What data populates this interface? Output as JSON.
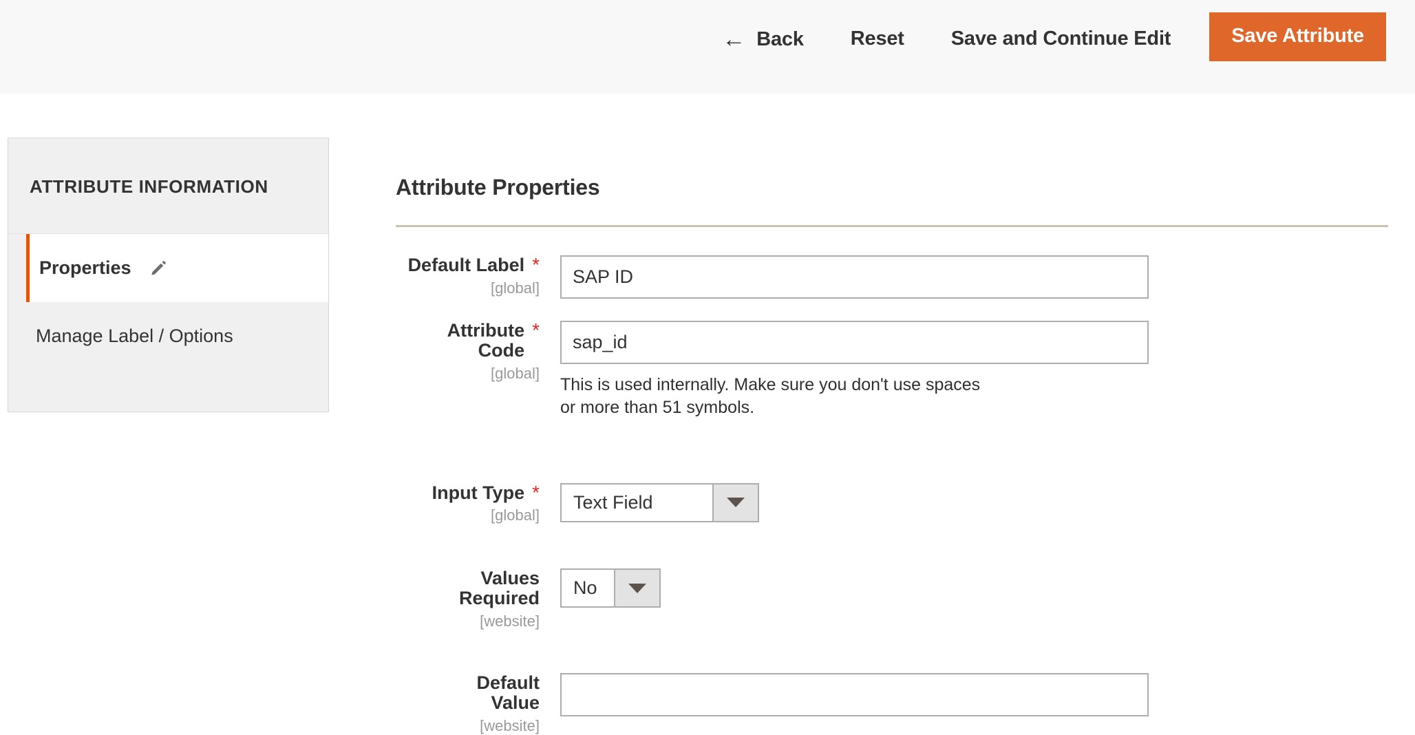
{
  "header": {
    "back_label": "Back",
    "back_icon": "arrow-left-icon",
    "reset_label": "Reset",
    "save_continue_label": "Save and Continue Edit",
    "save_label": "Save Attribute",
    "primary_color": "#e0672a",
    "bar_color": "#f8f8f8"
  },
  "sidebar": {
    "title": "ATTRIBUTE INFORMATION",
    "items": [
      {
        "label": "Properties",
        "active": true,
        "icon": "pencil-icon"
      },
      {
        "label": "Manage Label / Options",
        "active": false
      }
    ],
    "active_accent_color": "#eb5202"
  },
  "main": {
    "section_title": "Attribute Properties",
    "fields": {
      "default_label": {
        "label": "Default Label",
        "required_marker": "*",
        "scope": "[global]",
        "value": "SAP ID"
      },
      "attribute_code": {
        "label": "Attribute Code",
        "required_marker": "*",
        "scope": "[global]",
        "value": "sap_id",
        "note": "This is used internally. Make sure you don't use spaces or more than 51 symbols."
      },
      "input_type": {
        "label": "Input Type",
        "required_marker": "*",
        "scope": "[global]",
        "value": "Text Field"
      },
      "values_required": {
        "label_line1": "Values",
        "label_line2": "Required",
        "scope": "[website]",
        "value": "No"
      },
      "default_value": {
        "label_line1": "Default",
        "label_line2": "Value",
        "scope": "[website]",
        "value": "",
        "placeholder": ""
      }
    }
  }
}
